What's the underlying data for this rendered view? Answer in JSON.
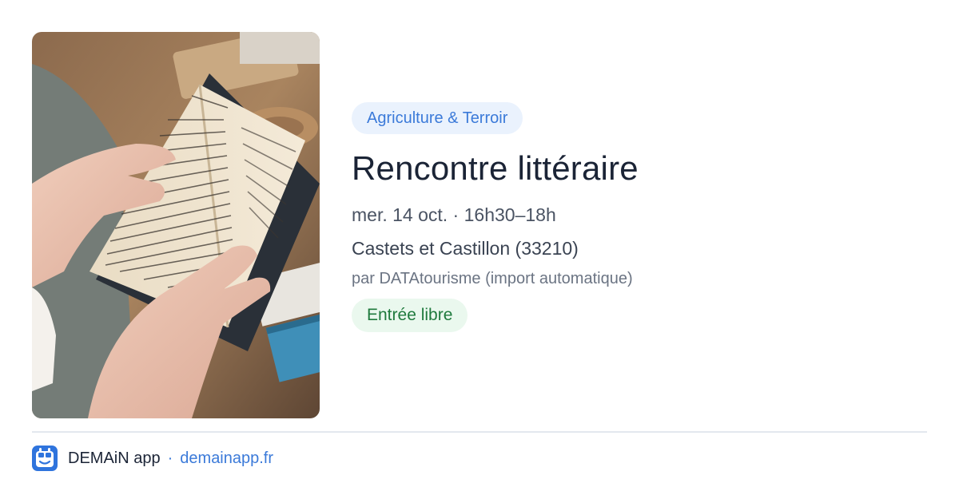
{
  "event": {
    "image_alt": "Hands holding an open book",
    "category": "Agriculture & Terroir",
    "title": "Rencontre littéraire",
    "datetime": "mer. 14 oct. · 16h30–18h",
    "location": "Castets et Castillon (33210)",
    "organizer": "par DATAtourisme (import automatique)",
    "price": "Entrée libre"
  },
  "footer": {
    "app_icon": "demain-app-icon",
    "app_name": "DEMAiN app",
    "separator": "·",
    "site": "demainapp.fr"
  },
  "colors": {
    "category_bg": "#eaf2fd",
    "category_text": "#3b7ad9",
    "price_bg": "#eaf8ee",
    "price_text": "#1f7a3d",
    "title_text": "#1b2436",
    "link": "#3b7ad9"
  }
}
